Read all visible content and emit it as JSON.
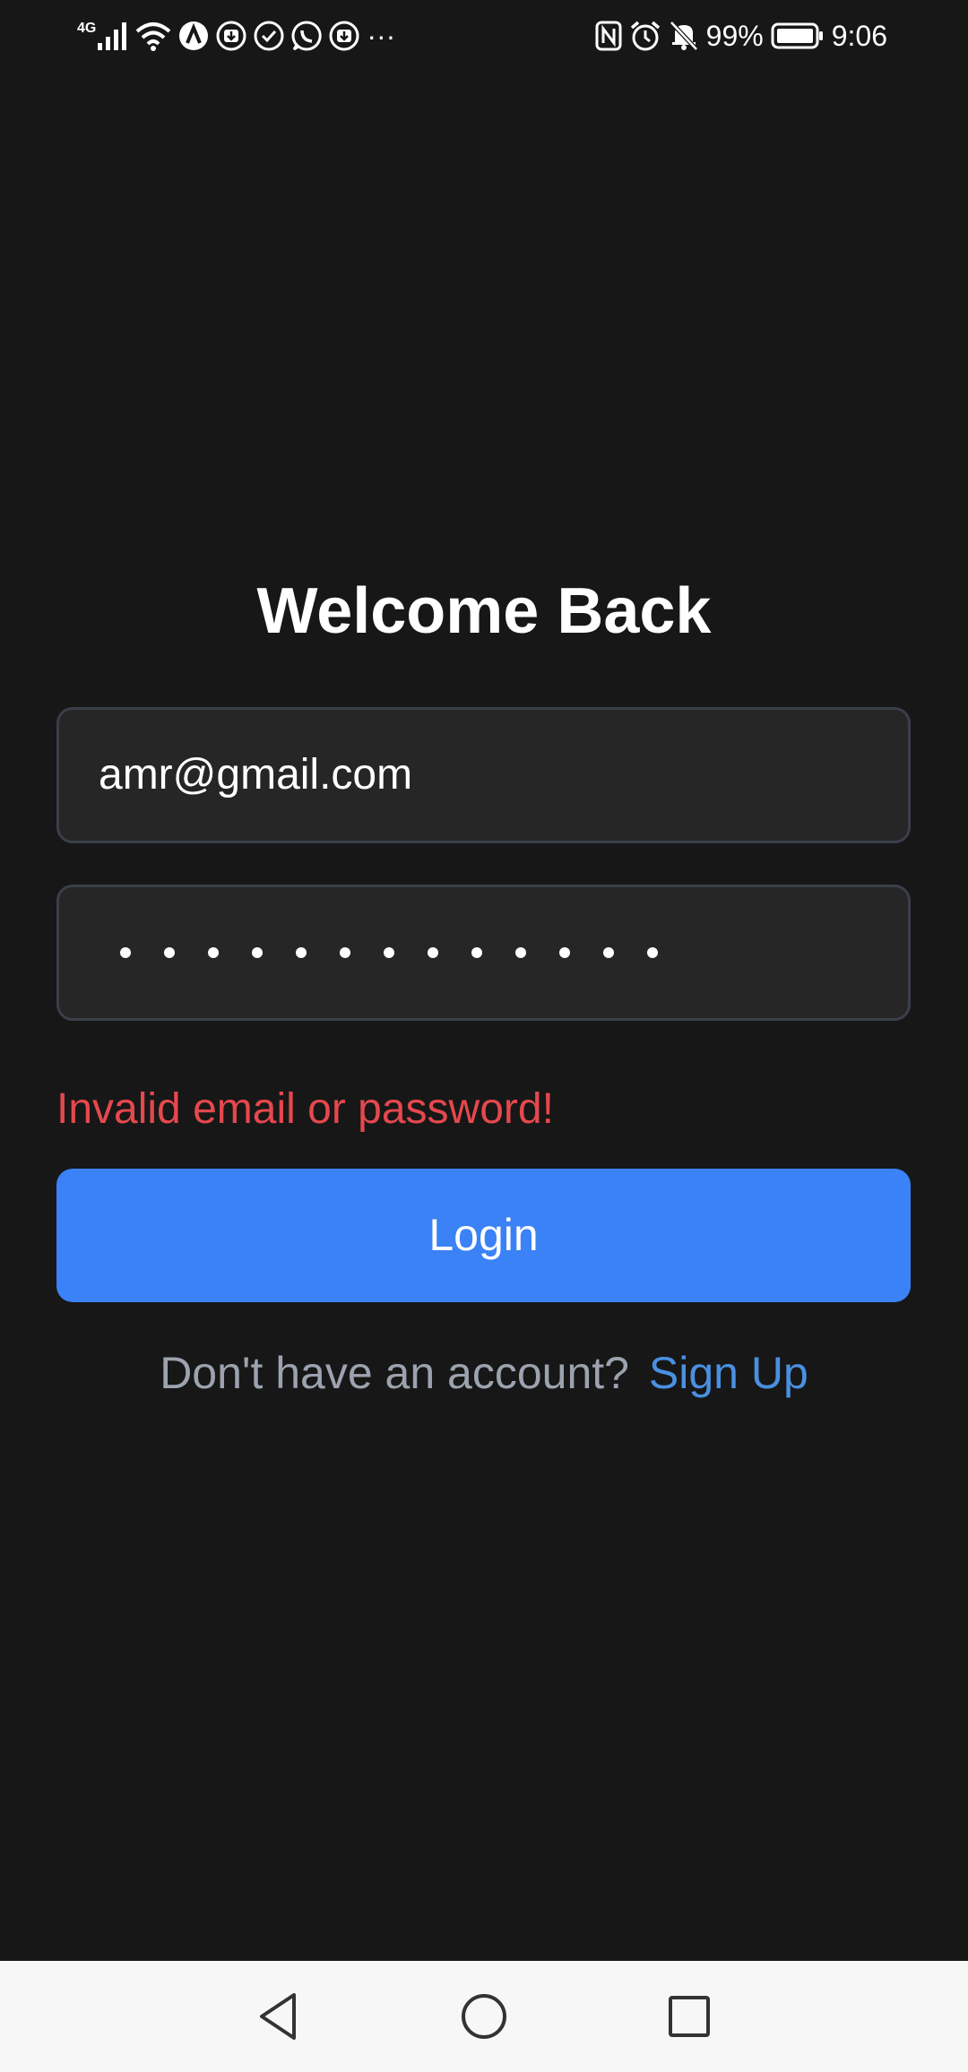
{
  "status_bar": {
    "network_type": "4G",
    "battery": "99%",
    "time": "9:06",
    "more": "···",
    "left_icons": [
      "signal-icon",
      "wifi-icon",
      "app-a-icon",
      "download-icon",
      "check-circle-icon",
      "whatsapp-icon",
      "download-icon"
    ],
    "right_icons": [
      "nfc-icon",
      "alarm-icon",
      "bell-off-icon",
      "battery-icon"
    ]
  },
  "login": {
    "title": "Welcome Back",
    "email_value": "amr@gmail.com",
    "password_mask_count": 13,
    "error_message": "Invalid email or password!",
    "login_label": "Login",
    "signup_prompt": "Don't have an account?",
    "signup_link": "Sign Up"
  },
  "nav_bar": {
    "buttons": [
      "back-icon",
      "home-icon",
      "recents-icon"
    ]
  },
  "colors": {
    "background": "#171717",
    "field_background": "#262626",
    "field_border": "#3a3f4a",
    "error": "#e5484d",
    "primary": "#3b82f6",
    "link": "#4a90e2",
    "muted_text": "#9ca3af",
    "nav_background": "#f7f7f7"
  }
}
